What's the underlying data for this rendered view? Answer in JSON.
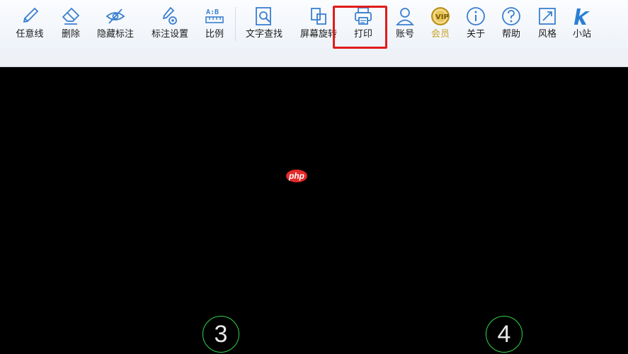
{
  "toolbar": {
    "items": [
      {
        "label": "任意线",
        "icon": "pen-icon"
      },
      {
        "label": "删除",
        "icon": "eraser-icon"
      },
      {
        "label": "隐藏标注",
        "icon": "eye-off-icon"
      },
      {
        "label": "标注设置",
        "icon": "pen-gear-icon"
      },
      {
        "label": "比例",
        "icon": "ruler-icon"
      },
      {
        "label": "文字查找",
        "icon": "text-search-icon"
      },
      {
        "label": "屏幕旋转",
        "icon": "rotate-screen-icon"
      },
      {
        "label": "打印",
        "icon": "printer-icon"
      },
      {
        "label": "账号",
        "icon": "user-icon"
      },
      {
        "label": "会员",
        "icon": "vip-icon"
      },
      {
        "label": "关于",
        "icon": "info-icon"
      },
      {
        "label": "帮助",
        "icon": "help-icon"
      },
      {
        "label": "风格",
        "icon": "style-icon"
      },
      {
        "label": "小站",
        "icon": "k-icon"
      }
    ],
    "highlighted": "打印"
  },
  "canvas": {
    "circles": [
      "3",
      "4"
    ],
    "watermark": "php"
  },
  "colors": {
    "accent": "#3a7fd0",
    "highlight": "#e11b1b",
    "vip": "#c7a227",
    "circle_stroke": "#2fd64a",
    "canvas_bg": "#000000"
  }
}
